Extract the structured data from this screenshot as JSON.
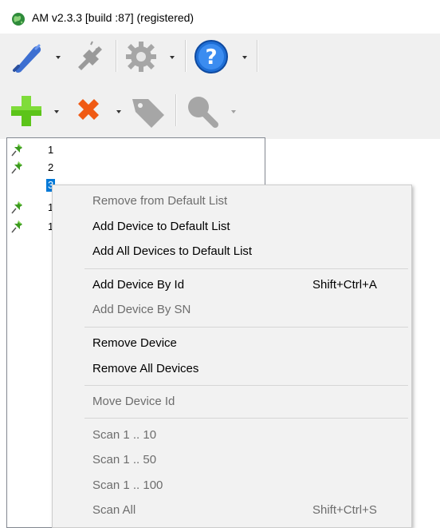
{
  "window": {
    "title": "AM v2.3.3 [build :87] (registered)",
    "icon": "globe-icon"
  },
  "toolbar": {
    "row1": [
      {
        "icon": "connect-plug-icon",
        "disabled": false,
        "has_dropdown": true
      },
      {
        "icon": "disconnect-plug-icon",
        "disabled": true,
        "has_dropdown": false
      },
      {
        "icon": "gear-icon",
        "disabled": true,
        "has_dropdown": true
      },
      {
        "icon": "help-icon",
        "disabled": false,
        "has_dropdown": true
      }
    ],
    "row2": [
      {
        "icon": "add-plus-icon",
        "disabled": false,
        "has_dropdown": true
      },
      {
        "icon": "remove-x-icon",
        "disabled": false,
        "has_dropdown": true
      },
      {
        "icon": "tag-icon",
        "disabled": true,
        "has_dropdown": false
      },
      {
        "icon": "search-icon",
        "disabled": true,
        "has_dropdown": true
      }
    ]
  },
  "device_list": {
    "items": [
      {
        "label": "1",
        "pinned": true,
        "selected": false
      },
      {
        "label": "2",
        "pinned": true,
        "selected": false
      },
      {
        "label": "3",
        "pinned": false,
        "selected": true
      },
      {
        "label": "1",
        "pinned": true,
        "selected": false
      },
      {
        "label": "1",
        "pinned": true,
        "selected": false
      }
    ]
  },
  "context_menu": {
    "items": [
      {
        "label": "Remove from Default List",
        "shortcut": "",
        "disabled": true
      },
      {
        "label": "Add Device to Default List",
        "shortcut": "",
        "disabled": false
      },
      {
        "label": "Add All Devices to Default List",
        "shortcut": "",
        "disabled": false
      },
      {
        "label": "Add Device By Id",
        "shortcut": "Shift+Ctrl+A",
        "disabled": false
      },
      {
        "label": "Add Device By SN",
        "shortcut": "",
        "disabled": true
      },
      {
        "label": "Remove Device",
        "shortcut": "",
        "disabled": false
      },
      {
        "label": "Remove All Devices",
        "shortcut": "",
        "disabled": false
      },
      {
        "label": "Move Device Id",
        "shortcut": "",
        "disabled": true
      },
      {
        "label": "Scan 1 .. 10",
        "shortcut": "",
        "disabled": true
      },
      {
        "label": "Scan 1 .. 50",
        "shortcut": "",
        "disabled": true
      },
      {
        "label": "Scan 1 .. 100",
        "shortcut": "",
        "disabled": true
      },
      {
        "label": "Scan All",
        "shortcut": "Shift+Ctrl+S",
        "disabled": true
      }
    ]
  },
  "colors": {
    "selection": "#0078d7",
    "menu_background": "#f2f2f2",
    "disabled_text": "#6d6d6d",
    "add_green": "#5cc41a",
    "remove_orange": "#f05a14",
    "help_blue": "#1f6fd6"
  }
}
